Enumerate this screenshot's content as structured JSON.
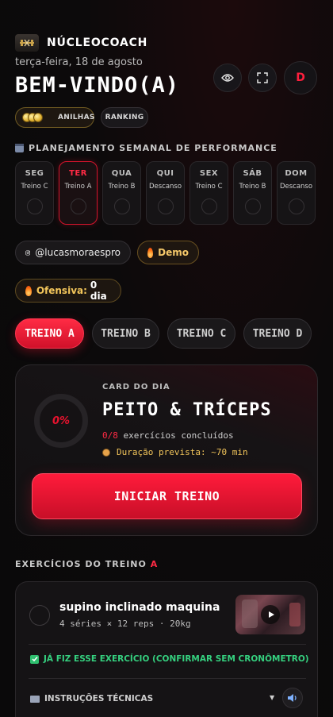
{
  "brand": {
    "name": "NÚCLEOCOACH",
    "logo_icon": "barbell-logo-icon"
  },
  "header": {
    "date": "terça-feira, 18 de agosto",
    "welcome": "BEM-VINDO(A)",
    "avatar_letter": "D"
  },
  "pills": {
    "anilhas": "ANILHAS",
    "ranking": "RANKING"
  },
  "week": {
    "title": "PLANEJAMENTO SEMANAL DE PERFORMANCE",
    "days": [
      {
        "name": "SEG",
        "plan": "Treino C"
      },
      {
        "name": "TER",
        "plan": "Treino A",
        "active": true
      },
      {
        "name": "QUA",
        "plan": "Treino B"
      },
      {
        "name": "QUI",
        "plan": "Descanso"
      },
      {
        "name": "SEX",
        "plan": "Treino C"
      },
      {
        "name": "SÁB",
        "plan": "Treino B"
      },
      {
        "name": "DOM",
        "plan": "Descanso"
      }
    ]
  },
  "chips": {
    "instagram": "@lucasmoraespro",
    "demo": "Demo",
    "ofensiva_label": "Ofensiva:",
    "ofensiva_value": "0 dia"
  },
  "tabs": [
    "TREINO A",
    "TREINO B",
    "TREINO C",
    "TREINO D"
  ],
  "card": {
    "kicker": "CARD DO DIA",
    "title": "PEITO & TRÍCEPS",
    "progress_pct": "0%",
    "done": "0/8",
    "done_label": "exercícios concluídos",
    "duration": "Duração prevista: ~70 min",
    "start_label": "INICIAR TREINO"
  },
  "exercises": {
    "title_prefix": "EXERCÍCIOS DO TREINO",
    "title_accent": "A",
    "items": [
      {
        "name": "supino inclinado maquina",
        "meta": "4 séries × 12 reps · 20kg",
        "confirm": "JÁ FIZ ESSE EXERCÍCIO (CONFIRMAR SEM CRONÔMETRO)",
        "instructions": "INSTRUÇÕES TÉCNICAS"
      }
    ]
  },
  "colors": {
    "accent": "#ff1f3d",
    "gold": "#f1c45a",
    "success": "#35d07f"
  }
}
